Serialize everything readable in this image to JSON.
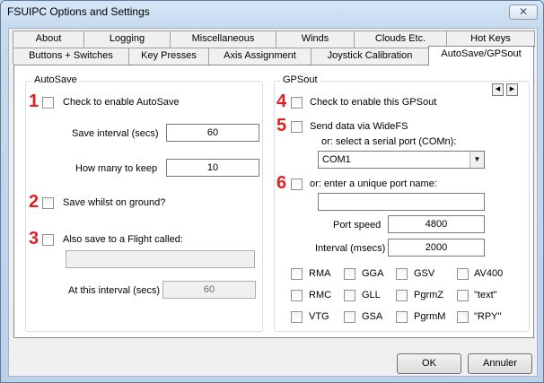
{
  "window": {
    "title": "FSUIPC Options and Settings",
    "close_glyph": "✕"
  },
  "tabs": {
    "row1": [
      "About",
      "Logging",
      "Miscellaneous",
      "Winds",
      "Clouds Etc.",
      "Hot Keys"
    ],
    "row2": [
      "Buttons + Switches",
      "Key Presses",
      "Axis Assignment",
      "Joystick Calibration",
      "AutoSave/GPSout"
    ],
    "active": "AutoSave/GPSout"
  },
  "annotation_numbers": [
    "1",
    "2",
    "3",
    "4",
    "5",
    "6"
  ],
  "autosave": {
    "legend": "AutoSave",
    "enable_label": "Check to enable AutoSave",
    "interval_label": "Save interval (secs)",
    "interval_value": "60",
    "keep_label": "How many to keep",
    "keep_value": "10",
    "ground_label": "Save whilst on ground?",
    "flight_label": "Also save to a Flight called:",
    "flight_value": "",
    "flight_interval_label": "At this interval (secs)",
    "flight_interval_value": "60"
  },
  "gpsout": {
    "legend": "GPSout",
    "enable_label": "Check to enable this GPSout",
    "widefs_label": "Send data via WideFS",
    "serial_label": "or: select a serial port (COMn):",
    "serial_value": "COM1",
    "unique_label": "or: enter a unique port name:",
    "unique_value": "",
    "speed_label": "Port speed",
    "speed_value": "4800",
    "interval_label": "Interval (msecs)",
    "interval_value": "2000",
    "sentences": [
      [
        "RMA",
        "GGA",
        "GSV",
        "AV400"
      ],
      [
        "RMC",
        "GLL",
        "PgrmZ",
        "\"text\""
      ],
      [
        "VTG",
        "GSA",
        "PgrmM",
        "\"RPY\""
      ]
    ]
  },
  "buttons": {
    "ok": "OK",
    "cancel": "Annuler"
  }
}
